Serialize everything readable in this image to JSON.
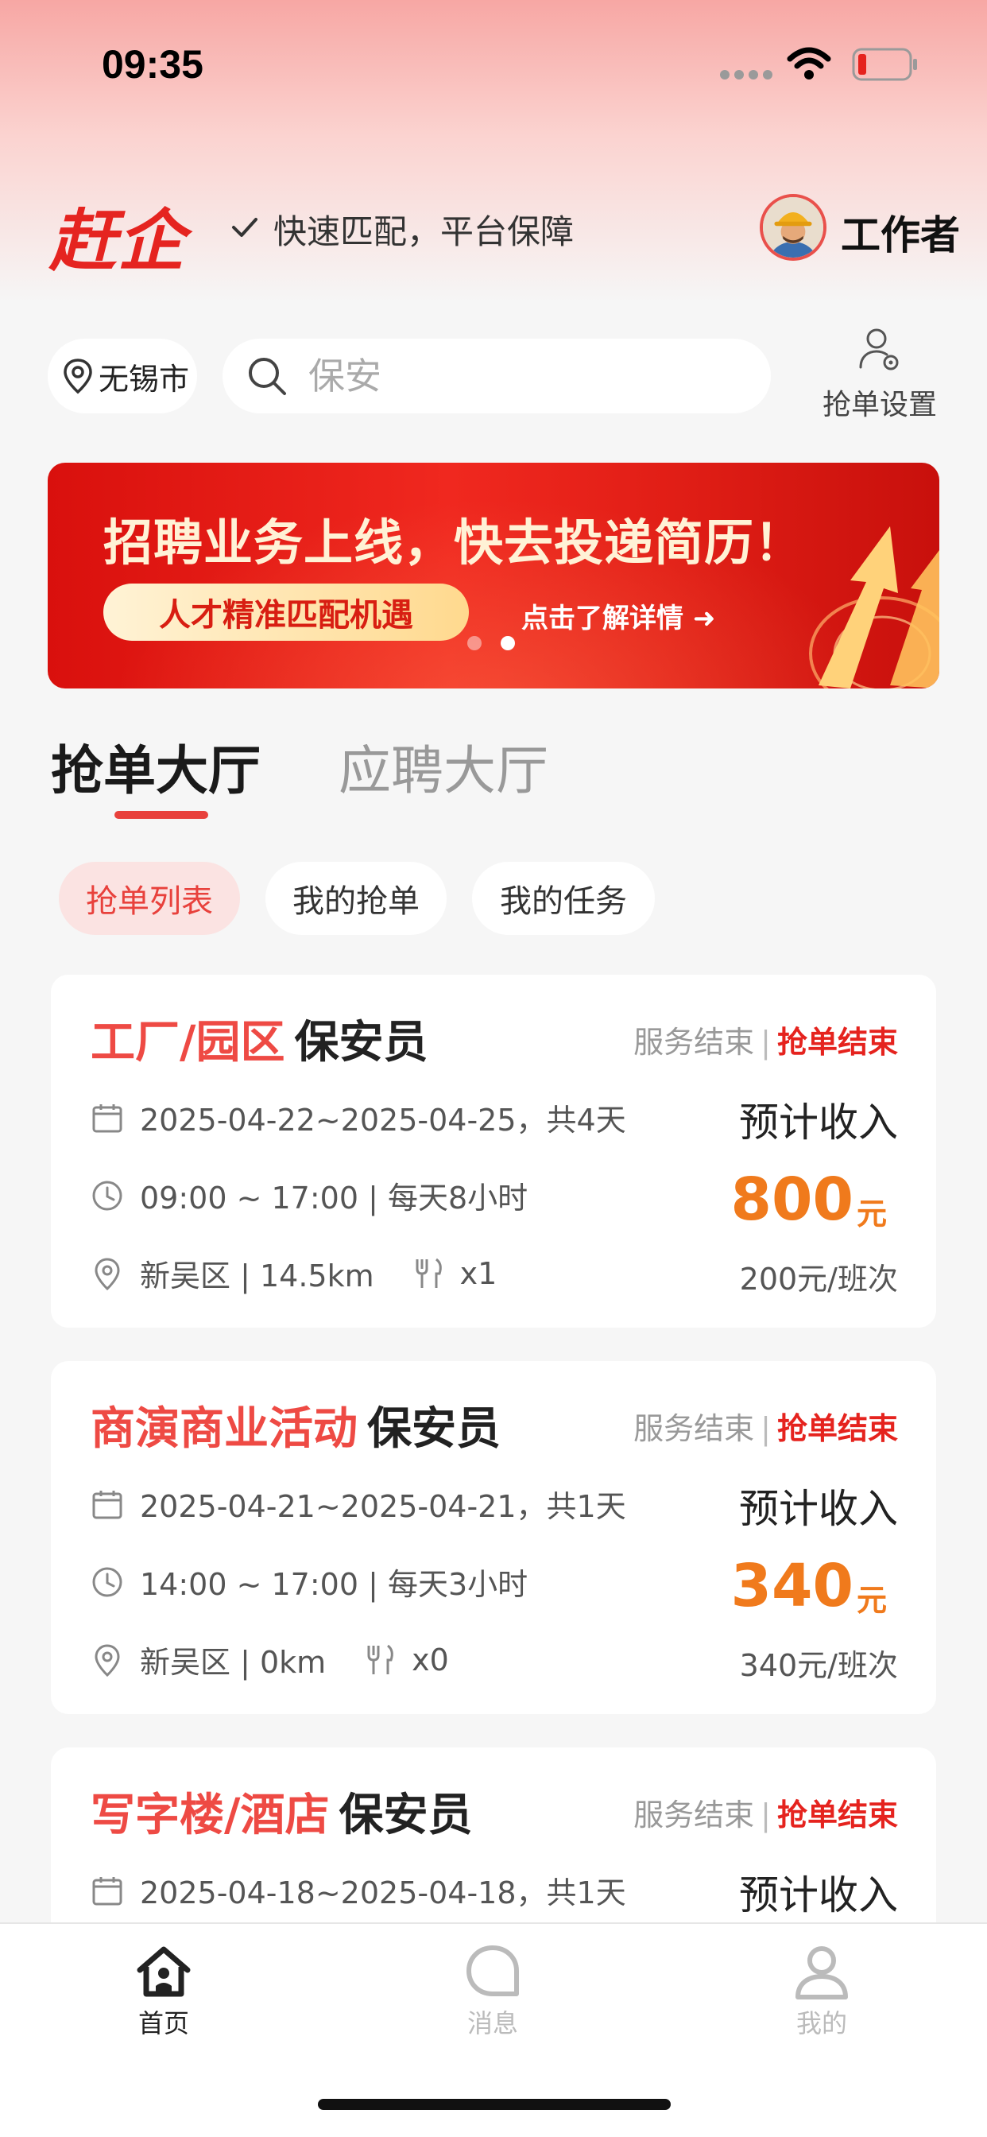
{
  "status_bar": {
    "time": "09:35"
  },
  "header": {
    "brand": "赶企",
    "tagline": "快速匹配，平台保障",
    "role": "工作者"
  },
  "search": {
    "city": "无锡市",
    "placeholder": "保安",
    "settings_label": "抢单设置"
  },
  "banner": {
    "headline": "招聘业务上线，快去投递简历！",
    "pill": "人才精准匹配机遇",
    "link": "点击了解详情 ➜",
    "slide_count": 2,
    "active_slide": 2
  },
  "tabs": [
    {
      "label": "抢单大厅",
      "active": true
    },
    {
      "label": "应聘大厅",
      "active": false
    }
  ],
  "filters": [
    {
      "label": "抢单列表",
      "active": true
    },
    {
      "label": "我的抢单",
      "active": false
    },
    {
      "label": "我的任务",
      "active": false
    }
  ],
  "jobs": [
    {
      "category": "工厂/园区",
      "role": "保安员",
      "status_service": "服务结束",
      "status_separator": "|",
      "status_grab": "抢单结束",
      "dates": "2025-04-22~2025-04-25，共4天",
      "hours": "09:00 ~ 17:00 | 每天8小时",
      "location": "新吴区 | 14.5km",
      "meals": "x1",
      "income_label": "预计收入",
      "income": "800",
      "income_unit": "元",
      "rate": "200元/班次"
    },
    {
      "category": "商演商业活动",
      "role": "保安员",
      "status_service": "服务结束",
      "status_separator": "|",
      "status_grab": "抢单结束",
      "dates": "2025-04-21~2025-04-21，共1天",
      "hours": "14:00 ~ 17:00 | 每天3小时",
      "location": "新吴区 | 0km",
      "meals": "x0",
      "income_label": "预计收入",
      "income": "340",
      "income_unit": "元",
      "rate": "340元/班次"
    },
    {
      "category": "写字楼/酒店",
      "role": "保安员",
      "status_service": "服务结束",
      "status_separator": "|",
      "status_grab": "抢单结束",
      "dates": "2025-04-18~2025-04-18，共1天",
      "income_label": "预计收入"
    }
  ],
  "bottom_nav": [
    {
      "label": "首页",
      "icon": "home-icon",
      "active": true
    },
    {
      "label": "消息",
      "icon": "message-icon",
      "active": false
    },
    {
      "label": "我的",
      "icon": "profile-icon",
      "active": false
    }
  ],
  "colors": {
    "brand_red": "#e52420",
    "accent_red": "#e8413c",
    "income_orange": "#f07a1c",
    "background": "#f6f6f6"
  }
}
